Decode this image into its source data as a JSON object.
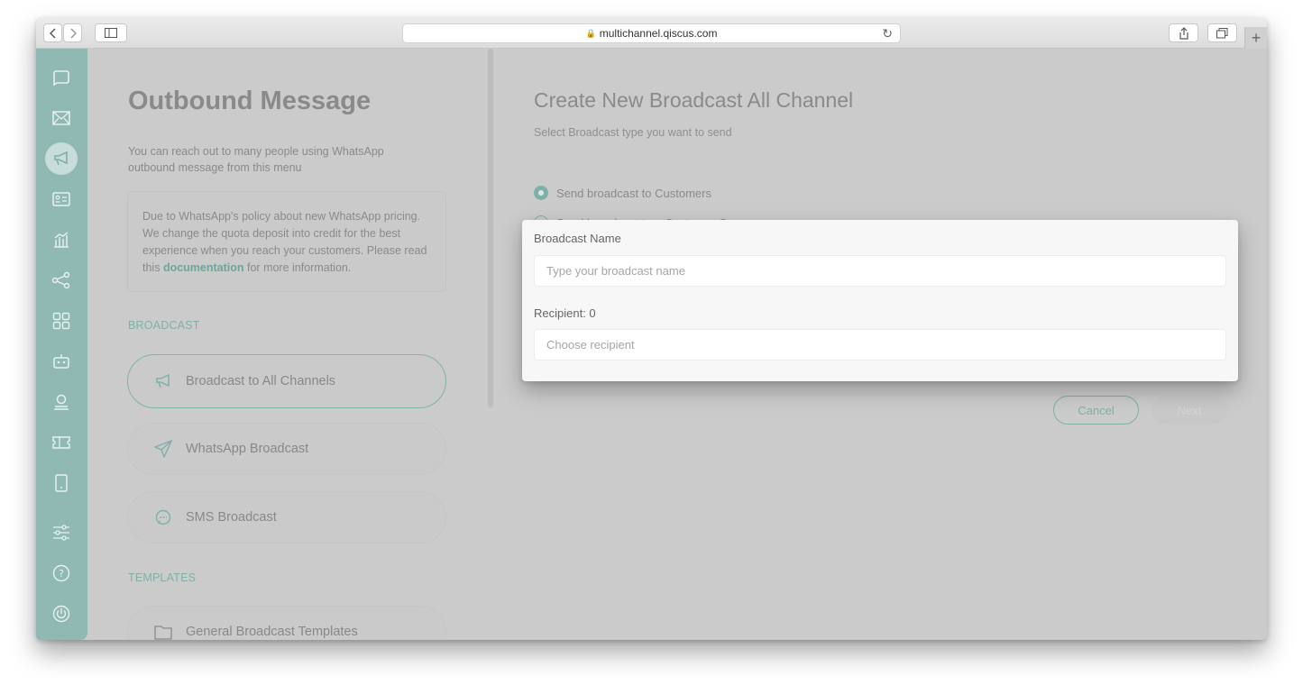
{
  "browser": {
    "url": "multichannel.qiscus.com"
  },
  "sidebar": {
    "icons": [
      "chat-icon",
      "inbox-icon",
      "broadcast-icon",
      "contacts-icon",
      "analytics-icon",
      "integration-icon",
      "apps-icon",
      "bot-icon",
      "agent-icon",
      "ticket-icon",
      "device-icon",
      "settings-icon",
      "help-icon",
      "power-icon"
    ]
  },
  "left": {
    "title": "Outbound Message",
    "description": "You can reach out to many people using WhatsApp outbound message from this menu",
    "notice_before": "Due to WhatsApp's policy about new WhatsApp pricing. We change the quota deposit into credit for the best experience when you reach your customers. Please read this ",
    "notice_link": "documentation",
    "notice_after": " for more information.",
    "broadcast_label": "BROADCAST",
    "nav": [
      {
        "label": "Broadcast to All Channels"
      },
      {
        "label": "WhatsApp Broadcast"
      },
      {
        "label": "SMS Broadcast"
      }
    ],
    "templates_label": "TEMPLATES",
    "templates_nav": [
      {
        "label": "General Broadcast Templates"
      }
    ]
  },
  "right": {
    "title": "Create New Broadcast All Channel",
    "subtitle": "Select Broadcast type you want to send",
    "radio_customers": "Send broadcast to Customers",
    "radio_group": "Send broadcast to a Customer Group",
    "cancel": "Cancel",
    "next": "Next"
  },
  "modal": {
    "name_label": "Broadcast Name",
    "name_placeholder": "Type your broadcast name",
    "recipient_label": "Recipient: 0",
    "recipient_placeholder": "Choose recipient"
  },
  "colors": {
    "accent": "#7fb0a8",
    "sidebar": "#8fb9b2",
    "overlay_bg": "#cbcbcb"
  }
}
